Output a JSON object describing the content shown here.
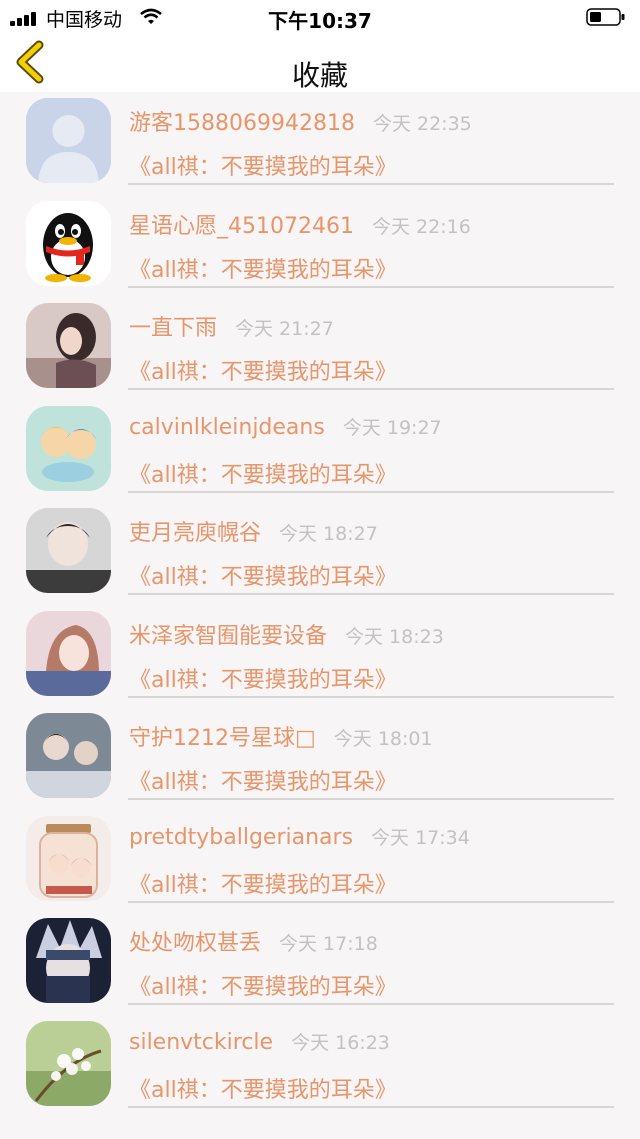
{
  "status": {
    "carrier": "中国移动",
    "time": "下午10:37"
  },
  "nav": {
    "title": "收藏"
  },
  "items": [
    {
      "name": "游客1588069942818",
      "time": "今天 22:35",
      "title": "《all祺：不要摸我的耳朵》",
      "avatar": "default-avatar"
    },
    {
      "name": "星语心愿_451072461",
      "time": "今天 22:16",
      "title": "《all祺：不要摸我的耳朵》",
      "avatar": "qq-penguin"
    },
    {
      "name": "一直下雨",
      "time": "今天 21:27",
      "title": "《all祺：不要摸我的耳朵》",
      "avatar": "photo-girl"
    },
    {
      "name": "calvinlkleinjdeans",
      "time": "今天 19:27",
      "title": "《all祺：不要摸我的耳朵》",
      "avatar": "cartoon-couple"
    },
    {
      "name": "吏月亮庾幌谷",
      "time": "今天 18:27",
      "title": "《all祺：不要摸我的耳朵》",
      "avatar": "photo-boy"
    },
    {
      "name": "米泽家智囿能要设备",
      "time": "今天 18:23",
      "title": "《all祺：不要摸我的耳朵》",
      "avatar": "anime-girl"
    },
    {
      "name": "守护1212号星球□",
      "time": "今天 18:01",
      "title": "《all祺：不要摸我的耳朵》",
      "avatar": "photo-two-boys"
    },
    {
      "name": "pretdtyballgerianars",
      "time": "今天 17:34",
      "title": "《all祺：不要摸我的耳朵》",
      "avatar": "bottle-anime"
    },
    {
      "name": "处处吻权甚丢",
      "time": "今天 17:18",
      "title": "《all祺：不要摸我的耳朵》",
      "avatar": "anime-ninja"
    },
    {
      "name": "silenvtckircle",
      "time": "今天 16:23",
      "title": "《all祺：不要摸我的耳朵》",
      "avatar": "white-flowers"
    }
  ]
}
